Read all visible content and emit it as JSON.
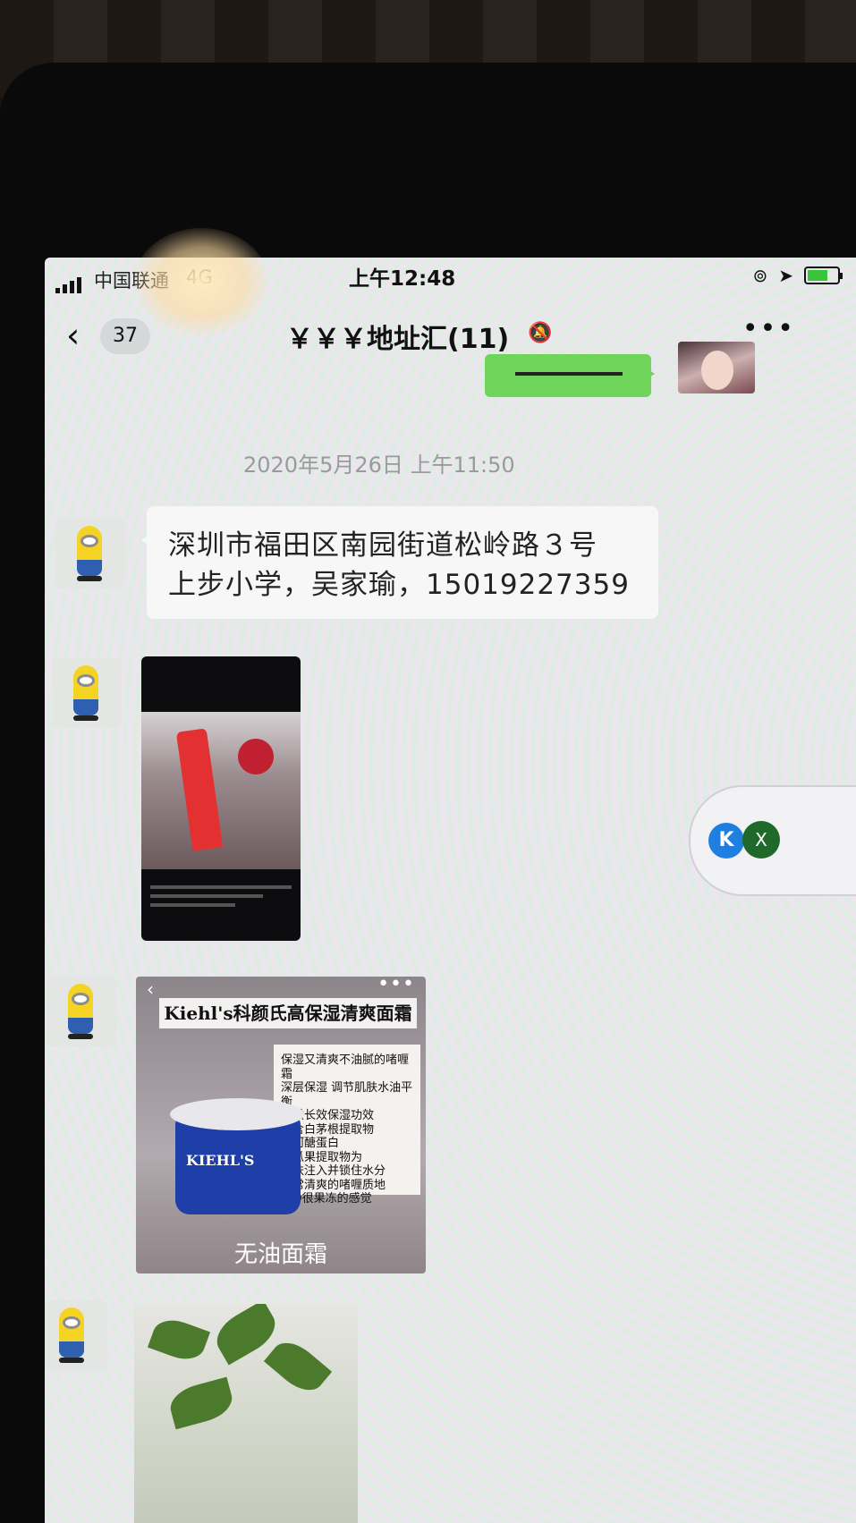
{
  "status_bar": {
    "carrier": "中国联通",
    "network": "4G",
    "time": "上午12:48"
  },
  "nav": {
    "unread_badge": "37",
    "title": "￥￥￥地址汇(11)"
  },
  "chat": {
    "timestamp": "2020年5月26日 上午11:50",
    "address_message_line1": "深圳市福田区南园街道松岭路３号",
    "address_message_line2": "上步小学，吴家瑜，15019227359",
    "kiehls_image": {
      "title": "Kiehl's科颜氏高保湿清爽面霜",
      "features": [
        "保湿又清爽不油腻的啫喱霜",
        "深层保湿 调节肌肤水油平衡",
        "提供长效保湿功效",
        "富含白茅根提取物",
        "冰河醣蛋白",
        "黄瓜果提取物为",
        "肌肤注入并锁住水分",
        "非常清爽的啫喱质地",
        "很Q很果冻的感觉"
      ],
      "jar_label": "KIEHL'S",
      "caption": "无油面霜"
    }
  },
  "floating_widget": {
    "left_icon_text": "K",
    "close_text": "X"
  }
}
